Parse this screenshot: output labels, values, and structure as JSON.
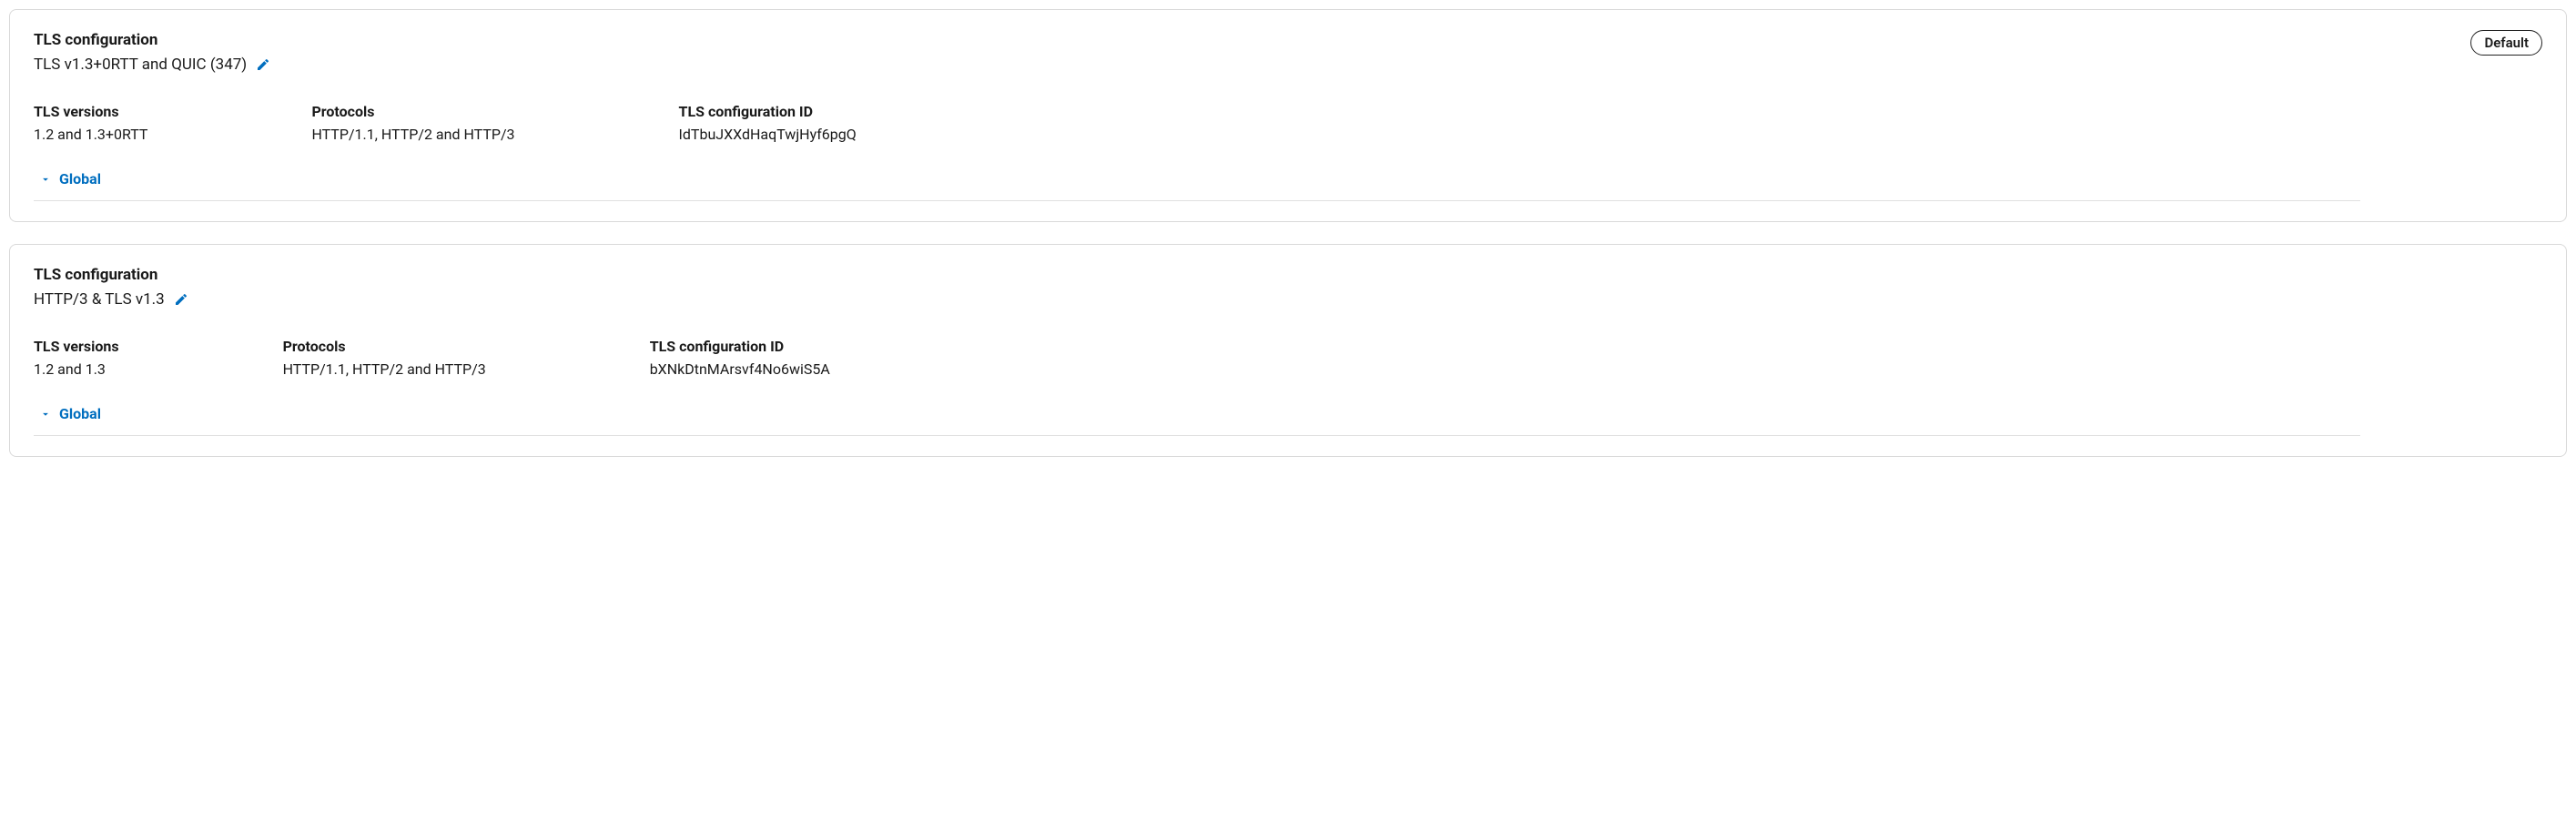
{
  "badge_default": "Default",
  "labels": {
    "title": "TLS configuration",
    "tls_versions": "TLS versions",
    "protocols": "Protocols",
    "config_id": "TLS configuration ID",
    "global": "Global"
  },
  "cards": [
    {
      "subtitle": "TLS v1.3+0RTT and QUIC (347)",
      "is_default": true,
      "tls_versions": "1.2 and 1.3+0RTT",
      "protocols": "HTTP/1.1, HTTP/2 and HTTP/3",
      "config_id": "IdTbuJXXdHaqTwjHyf6pgQ"
    },
    {
      "subtitle": "HTTP/3 & TLS v1.3",
      "is_default": false,
      "tls_versions": "1.2 and 1.3",
      "protocols": "HTTP/1.1, HTTP/2 and HTTP/3",
      "config_id": "bXNkDtnMArsvf4No6wiS5A"
    }
  ]
}
